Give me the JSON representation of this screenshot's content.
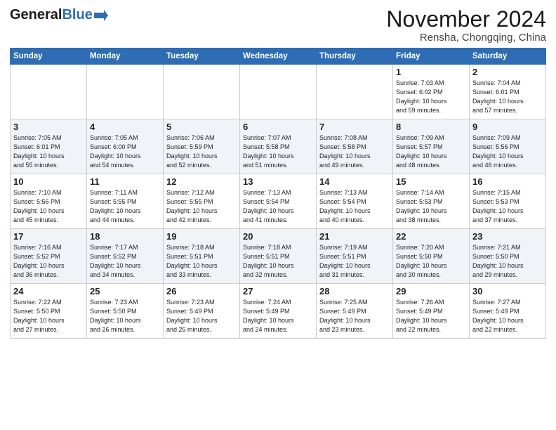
{
  "header": {
    "logo_general": "General",
    "logo_blue": "Blue",
    "title": "November 2024",
    "location": "Rensha, Chongqing, China"
  },
  "days_of_week": [
    "Sunday",
    "Monday",
    "Tuesday",
    "Wednesday",
    "Thursday",
    "Friday",
    "Saturday"
  ],
  "weeks": [
    [
      {
        "day": "",
        "info": ""
      },
      {
        "day": "",
        "info": ""
      },
      {
        "day": "",
        "info": ""
      },
      {
        "day": "",
        "info": ""
      },
      {
        "day": "",
        "info": ""
      },
      {
        "day": "1",
        "info": "Sunrise: 7:03 AM\nSunset: 6:02 PM\nDaylight: 10 hours\nand 59 minutes."
      },
      {
        "day": "2",
        "info": "Sunrise: 7:04 AM\nSunset: 6:01 PM\nDaylight: 10 hours\nand 57 minutes."
      }
    ],
    [
      {
        "day": "3",
        "info": "Sunrise: 7:05 AM\nSunset: 6:01 PM\nDaylight: 10 hours\nand 55 minutes."
      },
      {
        "day": "4",
        "info": "Sunrise: 7:05 AM\nSunset: 6:00 PM\nDaylight: 10 hours\nand 54 minutes."
      },
      {
        "day": "5",
        "info": "Sunrise: 7:06 AM\nSunset: 5:59 PM\nDaylight: 10 hours\nand 52 minutes."
      },
      {
        "day": "6",
        "info": "Sunrise: 7:07 AM\nSunset: 5:58 PM\nDaylight: 10 hours\nand 51 minutes."
      },
      {
        "day": "7",
        "info": "Sunrise: 7:08 AM\nSunset: 5:58 PM\nDaylight: 10 hours\nand 49 minutes."
      },
      {
        "day": "8",
        "info": "Sunrise: 7:09 AM\nSunset: 5:57 PM\nDaylight: 10 hours\nand 48 minutes."
      },
      {
        "day": "9",
        "info": "Sunrise: 7:09 AM\nSunset: 5:56 PM\nDaylight: 10 hours\nand 46 minutes."
      }
    ],
    [
      {
        "day": "10",
        "info": "Sunrise: 7:10 AM\nSunset: 5:56 PM\nDaylight: 10 hours\nand 45 minutes."
      },
      {
        "day": "11",
        "info": "Sunrise: 7:11 AM\nSunset: 5:55 PM\nDaylight: 10 hours\nand 44 minutes."
      },
      {
        "day": "12",
        "info": "Sunrise: 7:12 AM\nSunset: 5:55 PM\nDaylight: 10 hours\nand 42 minutes."
      },
      {
        "day": "13",
        "info": "Sunrise: 7:13 AM\nSunset: 5:54 PM\nDaylight: 10 hours\nand 41 minutes."
      },
      {
        "day": "14",
        "info": "Sunrise: 7:13 AM\nSunset: 5:54 PM\nDaylight: 10 hours\nand 40 minutes."
      },
      {
        "day": "15",
        "info": "Sunrise: 7:14 AM\nSunset: 5:53 PM\nDaylight: 10 hours\nand 38 minutes."
      },
      {
        "day": "16",
        "info": "Sunrise: 7:15 AM\nSunset: 5:53 PM\nDaylight: 10 hours\nand 37 minutes."
      }
    ],
    [
      {
        "day": "17",
        "info": "Sunrise: 7:16 AM\nSunset: 5:52 PM\nDaylight: 10 hours\nand 36 minutes."
      },
      {
        "day": "18",
        "info": "Sunrise: 7:17 AM\nSunset: 5:52 PM\nDaylight: 10 hours\nand 34 minutes."
      },
      {
        "day": "19",
        "info": "Sunrise: 7:18 AM\nSunset: 5:51 PM\nDaylight: 10 hours\nand 33 minutes."
      },
      {
        "day": "20",
        "info": "Sunrise: 7:18 AM\nSunset: 5:51 PM\nDaylight: 10 hours\nand 32 minutes."
      },
      {
        "day": "21",
        "info": "Sunrise: 7:19 AM\nSunset: 5:51 PM\nDaylight: 10 hours\nand 31 minutes."
      },
      {
        "day": "22",
        "info": "Sunrise: 7:20 AM\nSunset: 5:50 PM\nDaylight: 10 hours\nand 30 minutes."
      },
      {
        "day": "23",
        "info": "Sunrise: 7:21 AM\nSunset: 5:50 PM\nDaylight: 10 hours\nand 29 minutes."
      }
    ],
    [
      {
        "day": "24",
        "info": "Sunrise: 7:22 AM\nSunset: 5:50 PM\nDaylight: 10 hours\nand 27 minutes."
      },
      {
        "day": "25",
        "info": "Sunrise: 7:23 AM\nSunset: 5:50 PM\nDaylight: 10 hours\nand 26 minutes."
      },
      {
        "day": "26",
        "info": "Sunrise: 7:23 AM\nSunset: 5:49 PM\nDaylight: 10 hours\nand 25 minutes."
      },
      {
        "day": "27",
        "info": "Sunrise: 7:24 AM\nSunset: 5:49 PM\nDaylight: 10 hours\nand 24 minutes."
      },
      {
        "day": "28",
        "info": "Sunrise: 7:25 AM\nSunset: 5:49 PM\nDaylight: 10 hours\nand 23 minutes."
      },
      {
        "day": "29",
        "info": "Sunrise: 7:26 AM\nSunset: 5:49 PM\nDaylight: 10 hours\nand 22 minutes."
      },
      {
        "day": "30",
        "info": "Sunrise: 7:27 AM\nSunset: 5:49 PM\nDaylight: 10 hours\nand 22 minutes."
      }
    ]
  ]
}
